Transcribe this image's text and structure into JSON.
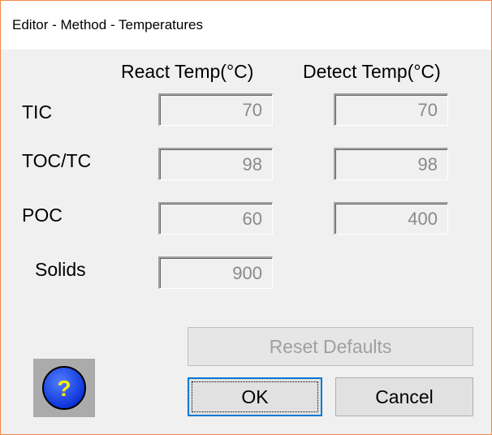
{
  "window": {
    "title": "Editor - Method - Temperatures"
  },
  "columns": {
    "react": "React Temp(°C)",
    "detect": "Detect Temp(°C)"
  },
  "rows": [
    {
      "label": "TIC",
      "react": "70",
      "detect": "70"
    },
    {
      "label": "TOC/TC",
      "react": "98",
      "detect": "98"
    },
    {
      "label": "POC",
      "react": "60",
      "detect": "400"
    },
    {
      "label": "Solids",
      "react": "900"
    }
  ],
  "buttons": {
    "reset_defaults": "Reset Defaults",
    "ok": "OK",
    "cancel": "Cancel",
    "help_icon_glyph": "?"
  },
  "icons": {
    "help": "help-question-icon"
  },
  "colors": {
    "window_border": "#f0894a",
    "help_blue": "#0a2fd6",
    "help_glyph": "#ffee00",
    "focus_blue": "#0078d7"
  }
}
